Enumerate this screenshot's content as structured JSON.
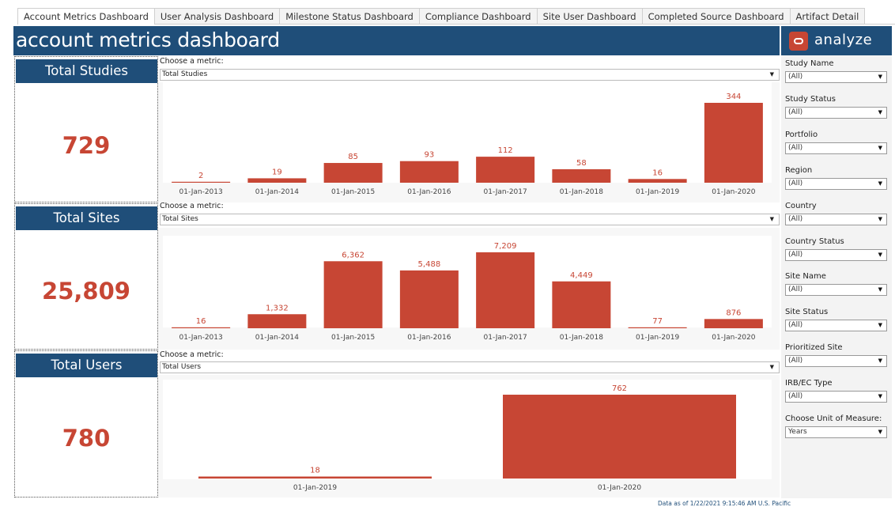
{
  "tabs": [
    {
      "label": "Account Metrics Dashboard",
      "active": true
    },
    {
      "label": "User Analysis Dashboard",
      "active": false
    },
    {
      "label": "Milestone Status Dashboard",
      "active": false
    },
    {
      "label": "Compliance Dashboard",
      "active": false
    },
    {
      "label": "Site User Dashboard",
      "active": false
    },
    {
      "label": "Completed Source Dashboard",
      "active": false
    },
    {
      "label": "Artifact Detail",
      "active": false
    }
  ],
  "header": {
    "title": "account metrics dashboard"
  },
  "logo": {
    "text": "analyze",
    "icon": "oracle-logo-icon"
  },
  "kpis": {
    "studies": {
      "label": "Total Studies",
      "value": "729"
    },
    "sites": {
      "label": "Total Sites",
      "value": "25,809"
    },
    "users": {
      "label": "Total Users",
      "value": "780"
    }
  },
  "metric_selectors": {
    "label": "Choose a metric:",
    "studies": "Total Studies",
    "sites": "Total Sites",
    "users": "Total Users"
  },
  "filters": [
    {
      "label": "Study Name",
      "value": "(All)"
    },
    {
      "label": "Study Status",
      "value": "(All)"
    },
    {
      "label": "Portfolio",
      "value": "(All)"
    },
    {
      "label": "Region",
      "value": "(All)"
    },
    {
      "label": "Country",
      "value": "(All)"
    },
    {
      "label": "Country Status",
      "value": "(All)"
    },
    {
      "label": "Site Name",
      "value": "(All)"
    },
    {
      "label": "Site Status",
      "value": "(All)"
    },
    {
      "label": "Prioritized Site",
      "value": "(All)"
    },
    {
      "label": "IRB/EC Type",
      "value": "(All)"
    },
    {
      "label": "Choose Unit of Measure:",
      "value": "Years"
    }
  ],
  "footer": {
    "note": "Data as of 1/22/2021 9:15:46 AM U.S. Pacific"
  },
  "colors": {
    "header": "#1f4e79",
    "bar": "#c74634",
    "value": "#c74634"
  },
  "chart_data": [
    {
      "type": "bar",
      "series": [
        {
          "values": [
            2,
            19,
            85,
            93,
            112,
            58,
            16,
            344
          ]
        }
      ],
      "categories": [
        "01-Jan-2013",
        "01-Jan-2014",
        "01-Jan-2015",
        "01-Jan-2016",
        "01-Jan-2017",
        "01-Jan-2018",
        "01-Jan-2019",
        "01-Jan-2020"
      ],
      "labels": [
        "2",
        "19",
        "85",
        "93",
        "112",
        "58",
        "16",
        "344"
      ],
      "ylim": [
        0,
        344
      ],
      "grid": false
    },
    {
      "type": "bar",
      "series": [
        {
          "values": [
            16,
            1332,
            6362,
            5488,
            7209,
            4449,
            77,
            876
          ]
        }
      ],
      "categories": [
        "01-Jan-2013",
        "01-Jan-2014",
        "01-Jan-2015",
        "01-Jan-2016",
        "01-Jan-2017",
        "01-Jan-2018",
        "01-Jan-2019",
        "01-Jan-2020"
      ],
      "labels": [
        "16",
        "1,332",
        "6,362",
        "5,488",
        "7,209",
        "4,449",
        "77",
        "876"
      ],
      "ylim": [
        0,
        7209
      ],
      "grid": false
    },
    {
      "type": "bar",
      "series": [
        {
          "values": [
            18,
            762
          ]
        }
      ],
      "categories": [
        "01-Jan-2019",
        "01-Jan-2020"
      ],
      "labels": [
        "18",
        "762"
      ],
      "ylim": [
        0,
        762
      ],
      "grid": false
    }
  ]
}
